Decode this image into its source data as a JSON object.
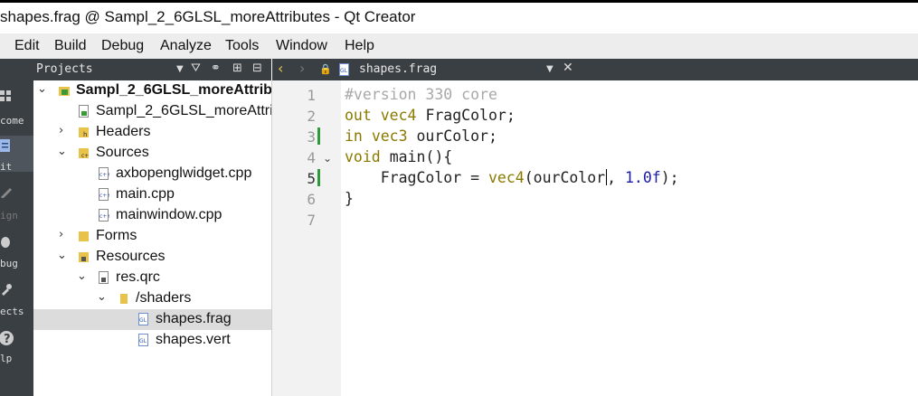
{
  "window": {
    "title": "shapes.frag @ Sampl_2_6GLSL_moreAttributes - Qt Creator"
  },
  "menu": [
    "Edit",
    "Build",
    "Debug",
    "Analyze",
    "Tools",
    "Window",
    "Help"
  ],
  "modes": [
    "come",
    "it",
    "ign",
    "bug",
    "ects",
    "lp"
  ],
  "navigator": {
    "title": "Projects",
    "tree": [
      {
        "label": "Sampl_2_6GLSL_moreAttribu",
        "icon": "project-icon",
        "expanded": true,
        "bold": true
      },
      {
        "label": "Sampl_2_6GLSL_moreAttrib",
        "icon": "pro-file-icon"
      },
      {
        "label": "Headers",
        "icon": "folder-headers-icon",
        "expanded": false
      },
      {
        "label": "Sources",
        "icon": "folder-sources-icon",
        "expanded": true
      },
      {
        "label": "axbopenglwidget.cpp",
        "icon": "cpp-file-icon"
      },
      {
        "label": "main.cpp",
        "icon": "cpp-file-icon"
      },
      {
        "label": "mainwindow.cpp",
        "icon": "cpp-file-icon"
      },
      {
        "label": "Forms",
        "icon": "folder-forms-icon",
        "expanded": false
      },
      {
        "label": "Resources",
        "icon": "folder-resources-icon",
        "expanded": true
      },
      {
        "label": "res.qrc",
        "icon": "qrc-file-icon",
        "expanded": true
      },
      {
        "label": "/shaders",
        "icon": "folder-icon",
        "expanded": true
      },
      {
        "label": "shapes.frag",
        "icon": "glsl-file-icon",
        "selected": true
      },
      {
        "label": "shapes.vert",
        "icon": "glsl-file-icon"
      }
    ]
  },
  "editor": {
    "document": "shapes.frag",
    "line_numbers": [
      "1",
      "2",
      "3",
      "4",
      "5",
      "6",
      "7"
    ],
    "current_line": 5,
    "code": {
      "l1": "#version 330 core",
      "l2_kw": "out",
      "l2_ty": "vec4",
      "l2_rest": "FragColor;",
      "l3_kw": "in",
      "l3_ty": "vec3",
      "l3_rest": "ourColor;",
      "l4_kw": "void",
      "l4_rest": "main(){",
      "l5_a": "    FragColor = ",
      "l5_fn": "vec4",
      "l5_b": "(ourColor",
      "l5_c": ", ",
      "l5_num": "1.0f",
      "l5_d": ");",
      "l6": "}",
      "l7": ""
    }
  },
  "colors": {
    "accent_change_marker": "#2e9a3b",
    "keyword": "#8a7a00",
    "number": "#1a1aa6"
  }
}
